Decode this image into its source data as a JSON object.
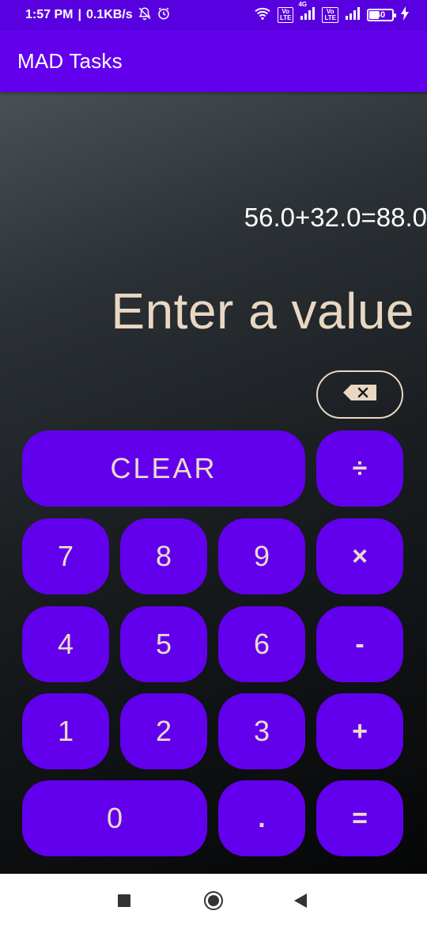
{
  "status_bar": {
    "time": "1:57 PM",
    "network_speed": "0.1KB/s",
    "network_type": "4G",
    "volte_label": "Vo\nLTE",
    "battery_level": "40",
    "icons": [
      "notifications-off-icon",
      "alarm-icon",
      "wifi-icon",
      "volte-icon",
      "signal-icon",
      "volte-icon",
      "signal-icon",
      "battery-icon",
      "charging-icon"
    ]
  },
  "app_bar": {
    "title": "MAD Tasks"
  },
  "calculator": {
    "history": "56.0+32.0=88.0",
    "display": "Enter a value",
    "backspace_icon": "backspace-icon",
    "keys": {
      "clear": "CLEAR",
      "divide": "÷",
      "seven": "7",
      "eight": "8",
      "nine": "9",
      "multiply": "×",
      "four": "4",
      "five": "5",
      "six": "6",
      "subtract": "-",
      "one": "1",
      "two": "2",
      "three": "3",
      "add": "+",
      "zero": "0",
      "decimal": ".",
      "equals": "="
    }
  },
  "colors": {
    "primary": "#6200ee",
    "status_bar": "#5900e0",
    "key_text": "#eadcc8",
    "display_text": "#e8d7c2"
  },
  "nav_bar": {
    "icons": [
      "recents-icon",
      "home-icon",
      "back-icon"
    ]
  }
}
